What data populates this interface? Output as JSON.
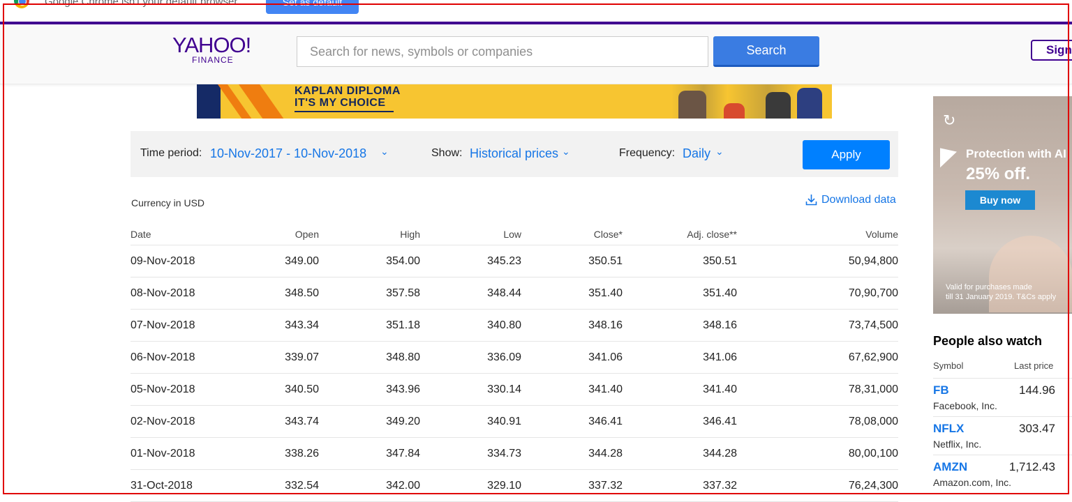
{
  "infobar": {
    "message": "Google Chrome isn't your default browser",
    "button": "Set as default"
  },
  "header": {
    "logo_line1": "YAHOO!",
    "logo_line2": "FINANCE",
    "search_placeholder": "Search for news, symbols or companies",
    "search_button": "Search",
    "signin_button": "Sign"
  },
  "banner": {
    "line1": "KAPLAN DIPLOMA",
    "line2": "IT'S MY CHOICE"
  },
  "filters": {
    "time_period_label": "Time period:",
    "time_period_value": "10-Nov-2017 - 10-Nov-2018",
    "show_label": "Show:",
    "show_value": "Historical prices",
    "frequency_label": "Frequency:",
    "frequency_value": "Daily",
    "apply_button": "Apply"
  },
  "currency_note": "Currency in USD",
  "download_label": "Download data",
  "table": {
    "headers": [
      "Date",
      "Open",
      "High",
      "Low",
      "Close*",
      "Adj. close**",
      "Volume"
    ],
    "rows": [
      [
        "09-Nov-2018",
        "349.00",
        "354.00",
        "345.23",
        "350.51",
        "350.51",
        "50,94,800"
      ],
      [
        "08-Nov-2018",
        "348.50",
        "357.58",
        "348.44",
        "351.40",
        "351.40",
        "70,90,700"
      ],
      [
        "07-Nov-2018",
        "343.34",
        "351.18",
        "340.80",
        "348.16",
        "348.16",
        "73,74,500"
      ],
      [
        "06-Nov-2018",
        "339.07",
        "348.80",
        "336.09",
        "341.06",
        "341.06",
        "67,62,900"
      ],
      [
        "05-Nov-2018",
        "340.50",
        "343.96",
        "330.14",
        "341.40",
        "341.40",
        "78,31,000"
      ],
      [
        "02-Nov-2018",
        "343.74",
        "349.20",
        "340.91",
        "346.41",
        "346.41",
        "78,08,000"
      ],
      [
        "01-Nov-2018",
        "338.26",
        "347.84",
        "334.73",
        "344.28",
        "344.28",
        "80,00,100"
      ],
      [
        "31-Oct-2018",
        "332.54",
        "342.00",
        "329.10",
        "337.32",
        "337.32",
        "76,24,300"
      ]
    ]
  },
  "side_ad": {
    "headline": "Protection with AI",
    "offer": "25% off.",
    "cta": "Buy now",
    "fine_print_1": "Valid for purchases made",
    "fine_print_2": "till 31 January 2019. T&Cs apply"
  },
  "people_also_watch": {
    "title": "People also watch",
    "symbol_header": "Symbol",
    "price_header": "Last price",
    "items": [
      {
        "symbol": "FB",
        "name": "Facebook, Inc.",
        "price": "144.96"
      },
      {
        "symbol": "NFLX",
        "name": "Netflix, Inc.",
        "price": "303.47"
      },
      {
        "symbol": "AMZN",
        "name": "Amazon.com, Inc.",
        "price": "1,712.43"
      }
    ]
  },
  "colors": {
    "brand_purple": "#400090",
    "link_blue": "#1676e6",
    "apply_blue": "#0080ff",
    "frame_red": "#e00000"
  }
}
